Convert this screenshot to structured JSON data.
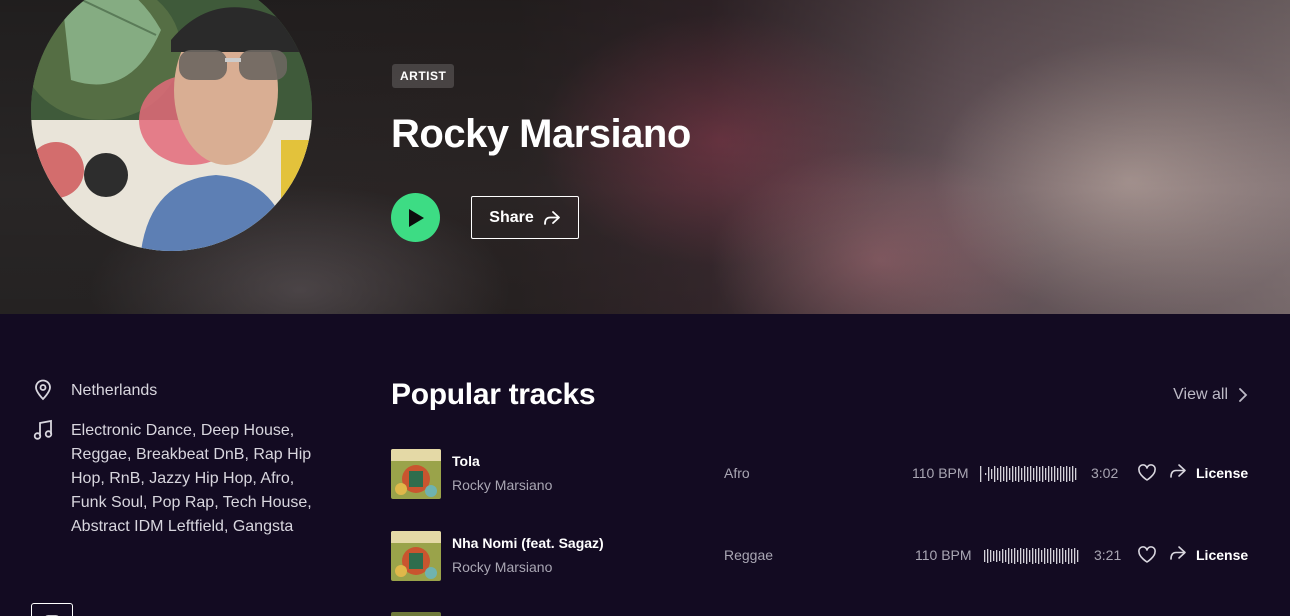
{
  "hero": {
    "badge": "ARTIST",
    "artist_name": "Rocky Marsiano",
    "share_label": "Share"
  },
  "sidebar": {
    "location": "Netherlands",
    "genres": "Electronic Dance, Deep House, Reggae, Breakbeat DnB, Rap Hip Hop, RnB, Jazzy Hip Hop, Afro, Funk Soul, Pop Rap, Tech House, Abstract IDM Leftfield, Gangsta"
  },
  "tracks_section": {
    "title": "Popular tracks",
    "view_all": "View all"
  },
  "tracks": [
    {
      "title": "Tola",
      "artist": "Rocky Marsiano",
      "genre": "Afro",
      "bpm": "110 BPM",
      "duration": "3:02",
      "license": "License"
    },
    {
      "title": "Nha Nomi (feat. Sagaz)",
      "artist": "Rocky Marsiano",
      "genre": "Reggae",
      "bpm": "110 BPM",
      "duration": "3:21",
      "license": "License"
    }
  ],
  "colors": {
    "background": "#130b22",
    "play_button": "#3ddc84",
    "muted_text": "#a9a6b3"
  },
  "icons": {
    "location": "map-pin-icon",
    "genres": "music-note-icon",
    "play": "play-icon",
    "share": "share-arrow-icon",
    "favorite": "heart-icon",
    "view_all": "chevron-right-icon"
  }
}
